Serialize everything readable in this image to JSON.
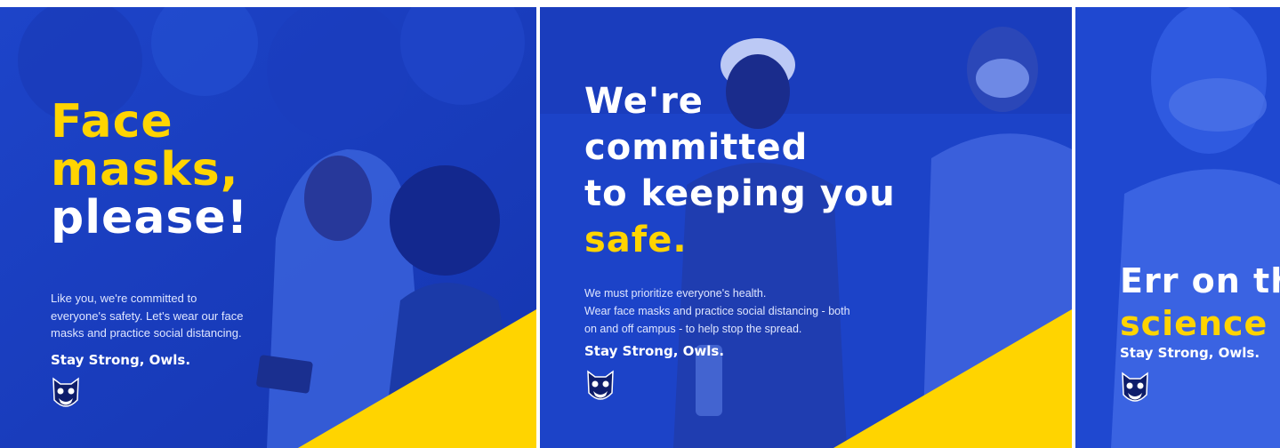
{
  "panels": [
    {
      "headline_lines": [
        "Face",
        "masks,",
        "please!"
      ],
      "body": [
        "Like you, we're committed to",
        "everyone's safety. Let's wear our face",
        "masks and practice social distancing."
      ],
      "tagline": "Stay Strong, Owls."
    },
    {
      "headline_lines": [
        "We're",
        "committed",
        "to keeping you",
        "safe."
      ],
      "body": [
        "We must prioritize everyone's health.",
        "Wear face masks and practice social distancing - both",
        "on and off campus - to help stop the spread."
      ],
      "tagline": "Stay Strong, Owls."
    },
    {
      "headline_lines": [
        "Err on th",
        "science"
      ],
      "tagline": "Stay Strong, Owls."
    }
  ],
  "colors": {
    "brand_blue": "#1a3fc4",
    "accent_yellow": "#ffd400",
    "text_white": "#ffffff"
  },
  "icons": [
    "owl-logo-icon"
  ]
}
